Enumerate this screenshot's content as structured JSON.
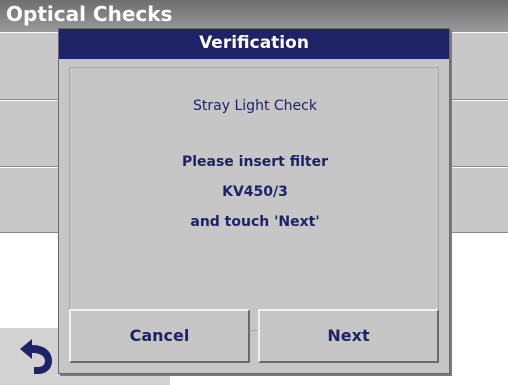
{
  "window": {
    "title": "Optical Checks"
  },
  "dialog": {
    "title": "Verification",
    "subtitle": "Stray Light Check",
    "message_line1": "Please insert filter",
    "message_line2": "KV450/3",
    "message_line3": "and touch 'Next'",
    "cancel_label": "Cancel",
    "next_label": "Next"
  },
  "icons": {
    "back": "back-arrow-icon"
  },
  "colors": {
    "dialog_header": "#1e2266",
    "text": "#1e2266",
    "panel": "#c6c6c6"
  }
}
